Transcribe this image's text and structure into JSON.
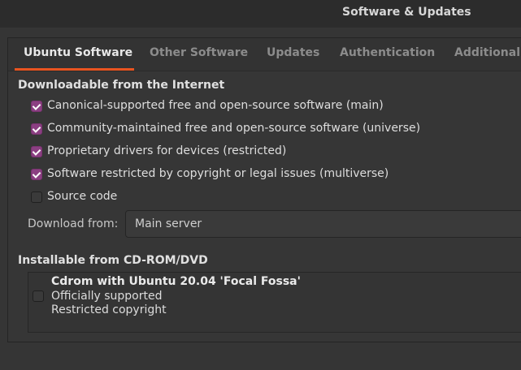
{
  "window": {
    "title": "Software & Updates"
  },
  "tabs": [
    {
      "label": "Ubuntu Software",
      "active": true
    },
    {
      "label": "Other Software",
      "active": false
    },
    {
      "label": "Updates",
      "active": false
    },
    {
      "label": "Authentication",
      "active": false
    },
    {
      "label": "Additional D",
      "active": false
    }
  ],
  "downloadable": {
    "title": "Downloadable from the Internet",
    "items": [
      {
        "label": "Canonical-supported free and open-source software (main)",
        "checked": true
      },
      {
        "label": "Community-maintained free and open-source software (universe)",
        "checked": true
      },
      {
        "label": "Proprietary drivers for devices (restricted)",
        "checked": true
      },
      {
        "label": "Software restricted by copyright or legal issues (multiverse)",
        "checked": true
      },
      {
        "label": "Source code",
        "checked": false
      }
    ],
    "download_from_label": "Download from:",
    "download_from_value": "Main server"
  },
  "cdrom": {
    "title": "Installable from CD-ROM/DVD",
    "entry": {
      "name": "Cdrom with Ubuntu 20.04 'Focal Fossa'",
      "line1": "Officially supported",
      "line2": "Restricted copyright",
      "checked": false
    }
  },
  "colors": {
    "accent_underline": "#e95420",
    "checkbox_checked": "#8b3f82"
  }
}
